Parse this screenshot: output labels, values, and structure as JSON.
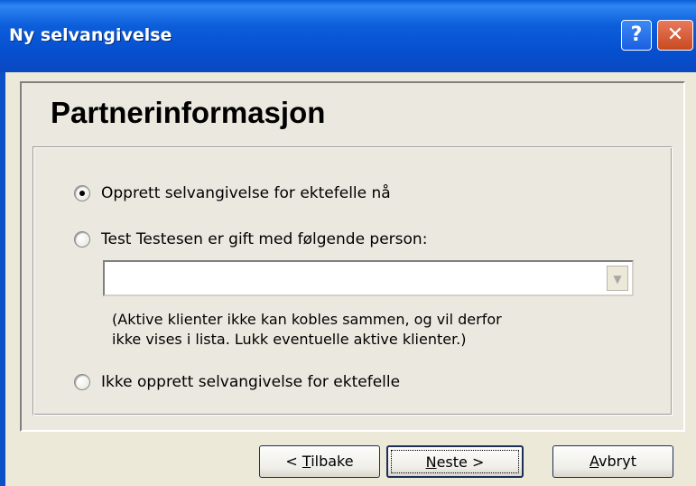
{
  "window": {
    "title": "Ny selvangivelse",
    "help_label": "?",
    "close_label": "✕"
  },
  "page": {
    "heading": "Partnerinformasjon"
  },
  "options": [
    {
      "label": "Opprett selvangivelse for ektefelle nå",
      "checked": true
    },
    {
      "label": "Test Testesen er gift med følgende person:",
      "checked": false
    },
    {
      "label": "Ikke opprett selvangivelse for ektefelle",
      "checked": false
    }
  ],
  "combo": {
    "value": "",
    "arrow": "▼"
  },
  "note": {
    "line1": "(Aktive klienter ikke kan kobles sammen, og vil derfor",
    "line2": "ikke vises i lista. Lukk eventuelle aktive klienter.)"
  },
  "buttons": {
    "back": {
      "prefix": "< ",
      "mnemonic": "T",
      "rest": "ilbake"
    },
    "next": {
      "mnemonic": "N",
      "rest": "este >"
    },
    "cancel": {
      "mnemonic": "A",
      "rest": "vbryt"
    }
  }
}
